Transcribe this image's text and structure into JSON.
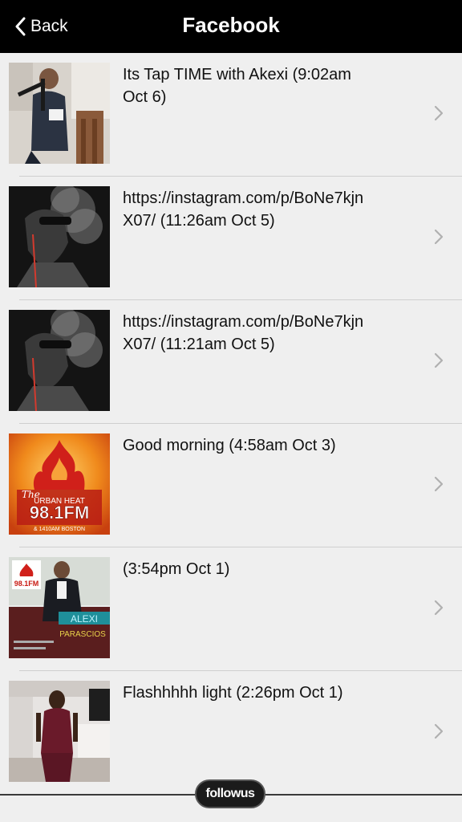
{
  "header": {
    "back_label": "Back",
    "title": "Facebook"
  },
  "posts": [
    {
      "text": "Its Tap TIME with Akexi (9:02am Oct 6)",
      "thumbnail": "studio-mic-photo"
    },
    {
      "text": "https://instagram.com/p/BoNe7kjnX07/ (11:26am Oct 5)",
      "thumbnail": "smoke-portrait-photo"
    },
    {
      "text": "https://instagram.com/p/BoNe7kjnX07/ (11:21am Oct 5)",
      "thumbnail": "smoke-portrait-photo"
    },
    {
      "text": "Good morning (4:58am Oct 3)",
      "thumbnail": "urban-heat-logo"
    },
    {
      "text": "(3:54pm Oct 1)",
      "thumbnail": "show-promo-photo"
    },
    {
      "text": "Flashhhhh light (2:26pm Oct 1)",
      "thumbnail": "tv-set-photo"
    }
  ],
  "logo": {
    "line1": "The",
    "line2": "URBAN HEAT",
    "line3": "98.1FM",
    "line4": "& 1410AM BOSTON"
  },
  "promo": {
    "station": "98.1FM",
    "name1": "ALEXI",
    "name2": "PARASCIOS"
  },
  "footer": {
    "follow_label": "followus"
  },
  "colors": {
    "navbar": "#000000",
    "background": "#efefef",
    "divider": "#cfcfcf",
    "chevron": "#b0b0b0"
  }
}
